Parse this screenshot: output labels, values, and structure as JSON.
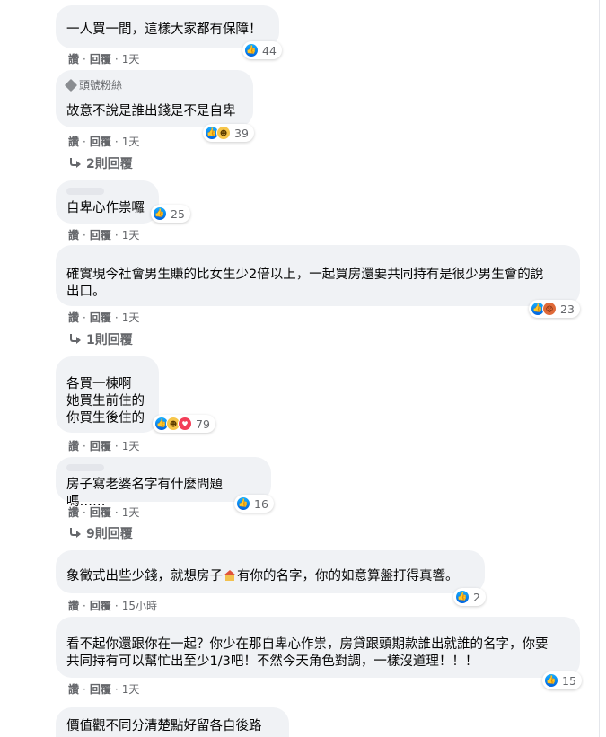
{
  "comments": [
    {
      "text": "一人買一間，這樣大家都有保障！",
      "reactions": {
        "count": "44",
        "icons": [
          "like-icon"
        ]
      },
      "actions": {
        "like": "讚",
        "reply": "回覆",
        "time": "1天"
      }
    },
    {
      "badge": "頭號粉絲",
      "text": "故意不說是誰出錢是不是自卑",
      "reactions": {
        "count": "39",
        "icons": [
          "like-icon",
          "haha-icon"
        ]
      },
      "actions": {
        "like": "讚",
        "reply": "回覆",
        "time": "1天"
      },
      "view_replies": "2則回覆"
    },
    {
      "text": "自卑心作祟囉",
      "reactions": {
        "count": "25",
        "icons": [
          "like-icon"
        ]
      },
      "actions": {
        "like": "讚",
        "reply": "回覆",
        "time": "1天"
      }
    },
    {
      "text": "確實現今社會男生賺的比女生少2倍以上，一起買房還要共同持有是很少男生會的說\n出口。",
      "reactions": {
        "count": "23",
        "icons": [
          "like-icon",
          "angry-icon"
        ]
      },
      "actions": {
        "like": "讚",
        "reply": "回覆",
        "time": "1天"
      },
      "view_replies": "1則回覆"
    },
    {
      "text": "各買一棟啊\n她買生前住的\n你買生後住的",
      "reactions": {
        "count": "79",
        "icons": [
          "like-icon",
          "haha-icon",
          "love-icon"
        ]
      },
      "actions": {
        "like": "讚",
        "reply": "回覆",
        "time": "1天"
      }
    },
    {
      "text": "房子寫老婆名字有什麼問題嗎……",
      "reactions": {
        "count": "16",
        "icons": [
          "like-icon"
        ]
      },
      "actions": {
        "like": "讚",
        "reply": "回覆",
        "time": "1天"
      },
      "view_replies": "9則回覆"
    },
    {
      "text_before_emoji": "象徵式出些少錢，就想房子",
      "text_after_emoji": "有你的名字，你的如意算盤打得真響。",
      "reactions": {
        "count": "2",
        "icons": [
          "like-icon"
        ]
      },
      "actions": {
        "like": "讚",
        "reply": "回覆",
        "time": "15小時"
      }
    },
    {
      "text": "看不起你還跟你在一起？你少在那自卑心作祟，房貸跟頭期款誰出就誰的名字，你要\n共同持有可以幫忙出至少1/3吧！不然今天角色對調，一樣沒道理！！！",
      "reactions": {
        "count": "15",
        "icons": [
          "like-icon"
        ]
      },
      "actions": {
        "like": "讚",
        "reply": "回覆",
        "time": "1天"
      }
    },
    {
      "text": "價值觀不同分清楚點好留各自後路"
    }
  ],
  "colors": {
    "bubble": "#f0f2f5",
    "secondary_text": "#65676b",
    "like_blue": "#0866ff"
  }
}
